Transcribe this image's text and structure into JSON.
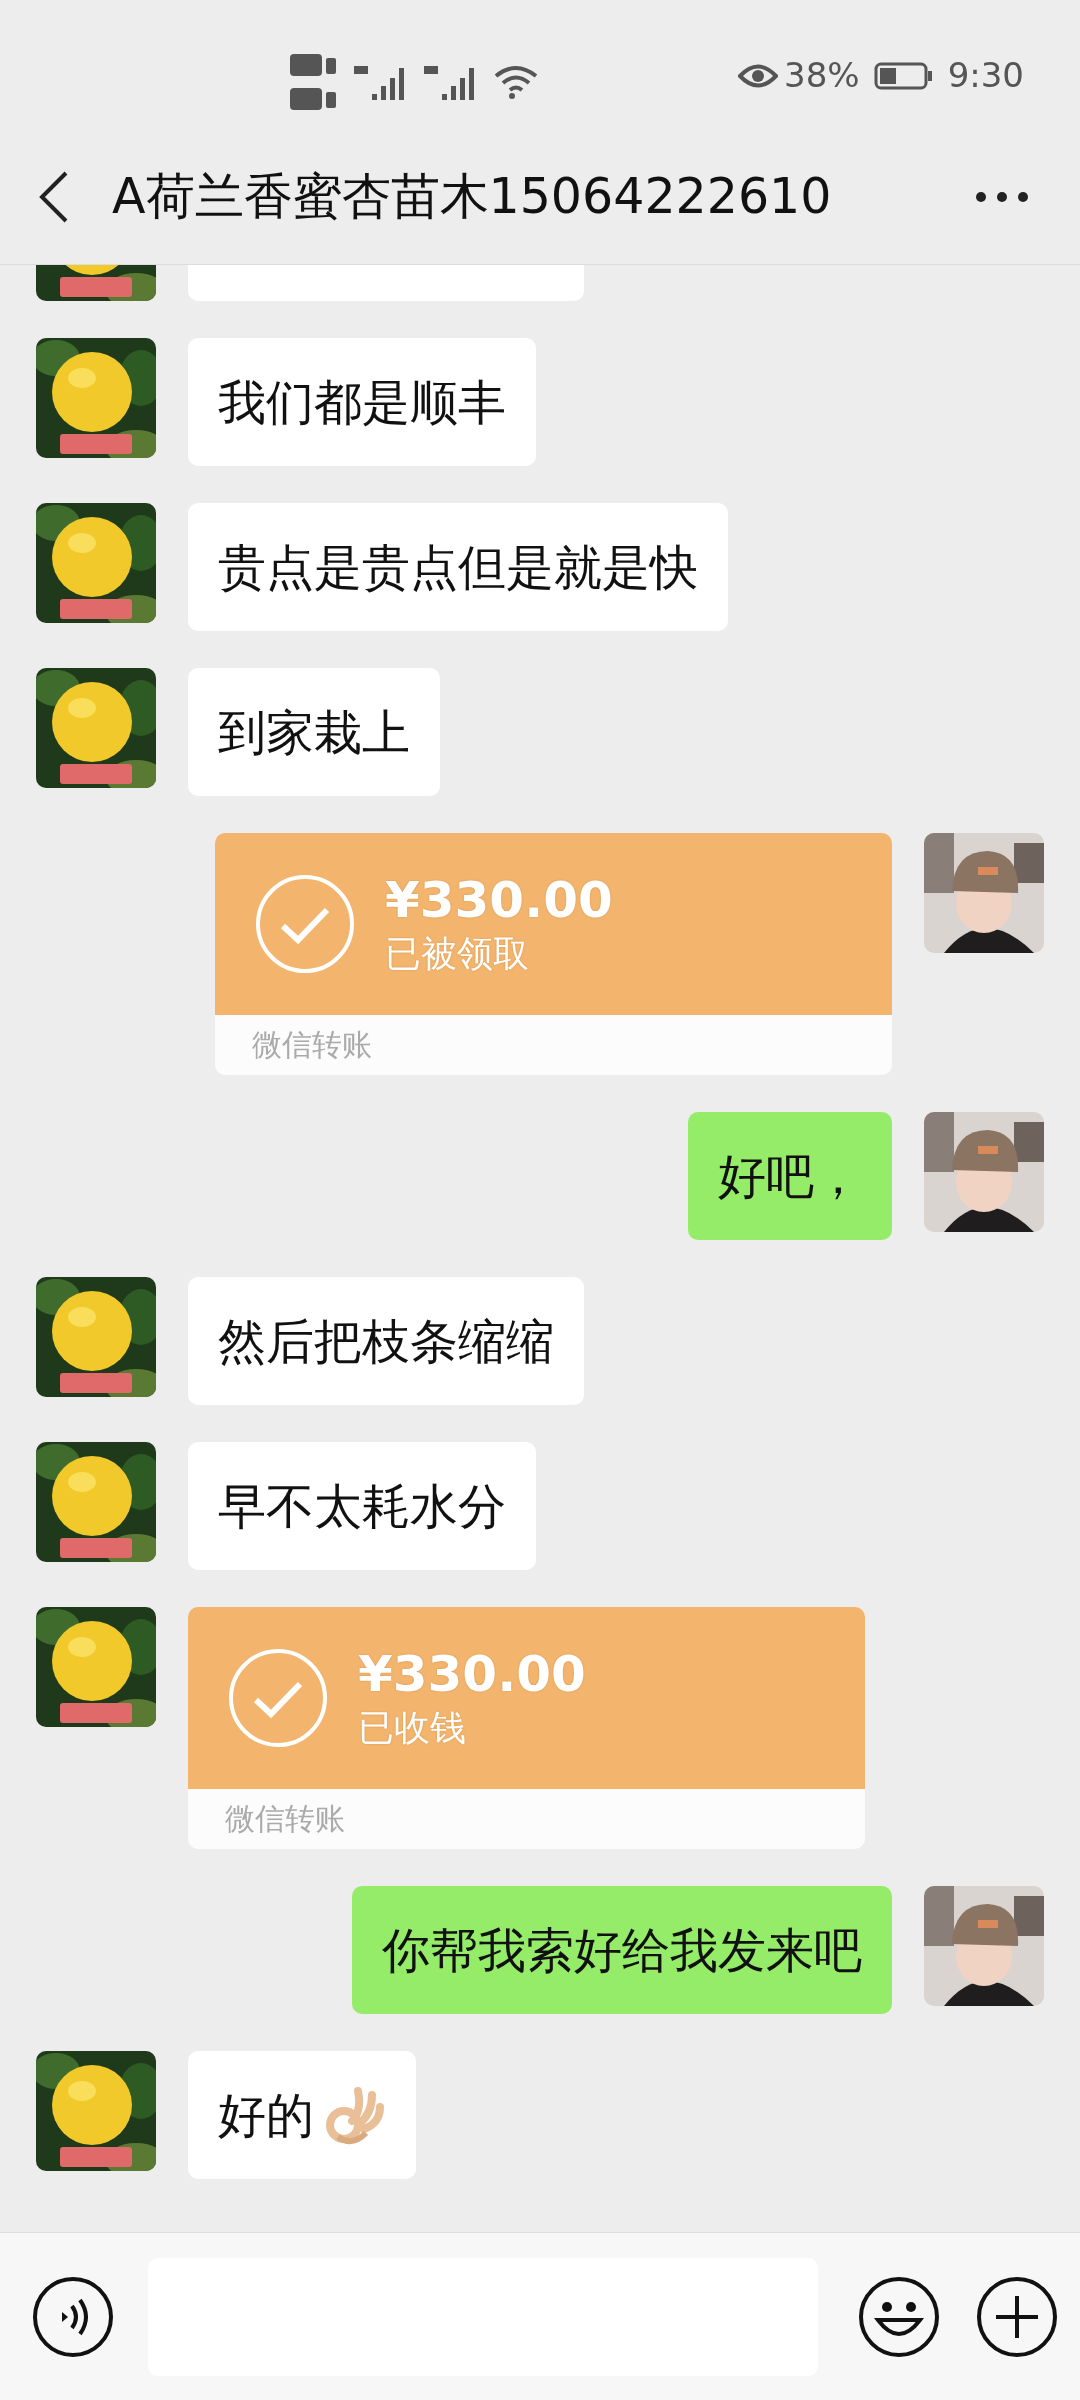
{
  "status_bar": {
    "battery": "38%",
    "time": "9:30"
  },
  "header": {
    "title": "A荷兰香蜜杏苗木15064222610"
  },
  "messages": [
    {
      "kind": "partial",
      "outgoing": false
    },
    {
      "kind": "text",
      "outgoing": false,
      "text": "我们都是顺丰"
    },
    {
      "kind": "text",
      "outgoing": false,
      "text": "贵点是贵点但是就是快"
    },
    {
      "kind": "text",
      "outgoing": false,
      "text": "到家栽上"
    },
    {
      "kind": "transfer",
      "outgoing": true,
      "amount": "¥330.00",
      "status": "已被领取",
      "footer": "微信转账"
    },
    {
      "kind": "text",
      "outgoing": true,
      "text": "好吧，"
    },
    {
      "kind": "text",
      "outgoing": false,
      "text": "然后把枝条缩缩"
    },
    {
      "kind": "text",
      "outgoing": false,
      "text": "早不太耗水分"
    },
    {
      "kind": "transfer",
      "outgoing": false,
      "amount": "¥330.00",
      "status": "已收钱",
      "footer": "微信转账"
    },
    {
      "kind": "text",
      "outgoing": true,
      "text": "你帮我索好给我发来吧"
    },
    {
      "kind": "text_ok",
      "outgoing": false,
      "text": "好的"
    }
  ]
}
